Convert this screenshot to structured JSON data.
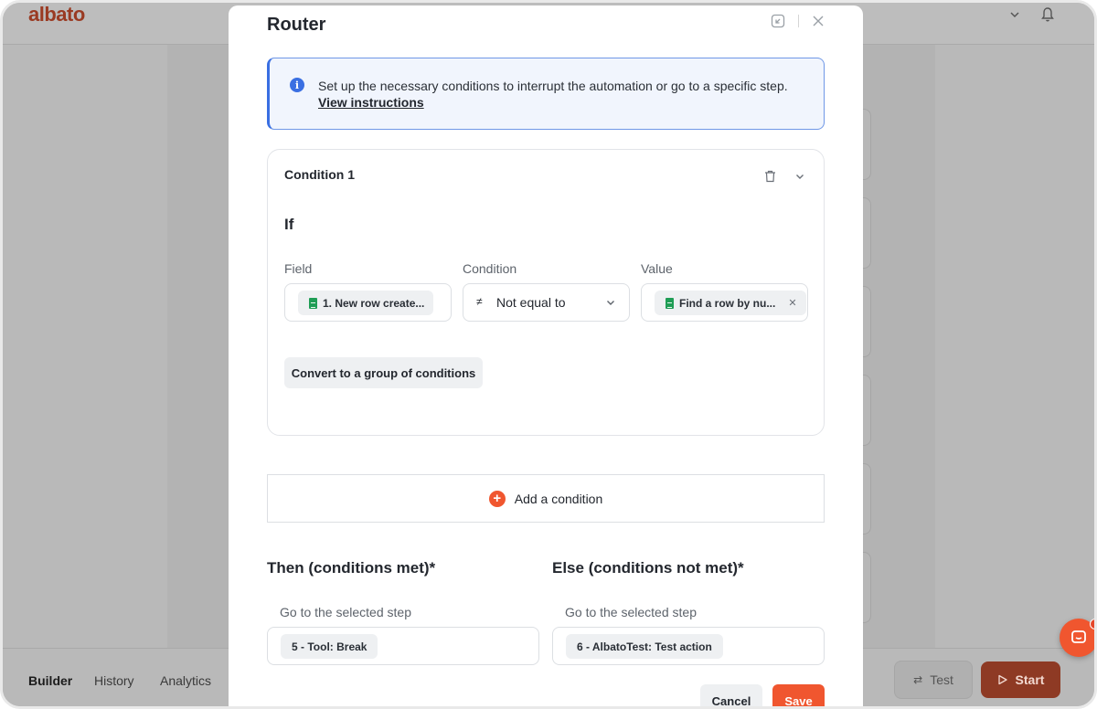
{
  "app": {
    "logo": "albato",
    "bottom_tabs": [
      "Builder",
      "History",
      "Analytics"
    ],
    "test_label": "Test",
    "start_label": "Start",
    "accent_color": "#f0562f"
  },
  "modal": {
    "title": "Router",
    "info": {
      "text": "Set up the necessary conditions to interrupt the automation or go to a specific step.",
      "link": "View instructions"
    },
    "condition": {
      "title": "Condition 1",
      "if_label": "If",
      "field_label": "Field",
      "condition_label": "Condition",
      "value_label": "Value",
      "field_value": "1. New row create...",
      "condition_symbol": "≠",
      "condition_value": "Not equal to",
      "value_value": "Find a row by nu...",
      "convert_label": "Convert to a group of conditions"
    },
    "add_condition_label": "Add a condition",
    "then": {
      "title": "Then (conditions met)*",
      "sub": "Go to the selected step",
      "value": "5 - Tool: Break"
    },
    "else": {
      "title": "Else (conditions not met)*",
      "sub": "Go to the selected step",
      "value": "6 - AlbatoTest: Test action"
    },
    "cancel_label": "Cancel",
    "save_label": "Save"
  }
}
